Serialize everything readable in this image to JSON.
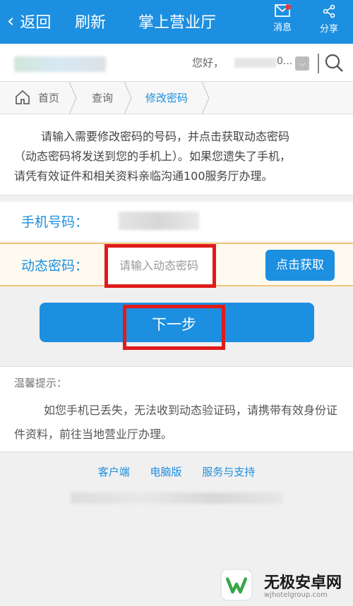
{
  "topbar": {
    "back_label": "返回",
    "refresh_label": "刷新",
    "title": "掌上营业厅",
    "messages_label": "消息",
    "share_label": "分享"
  },
  "userbar": {
    "greeting": "您好，",
    "greeting_tail": "0..."
  },
  "breadcrumb": {
    "home": "首页",
    "query": "查询",
    "current": "修改密码"
  },
  "intro": {
    "line1": "请输入需要修改密码的号码，并点击获取动态密码",
    "line2": "（动态密码将发送到您的手机上）。如果您遗失了手机，",
    "line3": "请凭有效证件和相关资料亲临沟通100服务厅办理。"
  },
  "form": {
    "phone_label": "手机号码：",
    "code_label": "动态密码：",
    "code_placeholder": "请输入动态密码",
    "get_code_button": "点击获取",
    "next_button": "下一步"
  },
  "tips": {
    "heading": "温馨提示：",
    "body": "如您手机已丢失，无法收到动态验证码，请携带有效身份证件资料，前往当地营业厅办理。"
  },
  "footer": {
    "links": [
      "客户端",
      "电脑版",
      "服务与支持"
    ]
  },
  "watermark": {
    "name": "无极安卓网",
    "url": "wjhotelgroup.com"
  },
  "colors": {
    "primary": "#1c8fe0",
    "highlight": "#e01b1b"
  }
}
